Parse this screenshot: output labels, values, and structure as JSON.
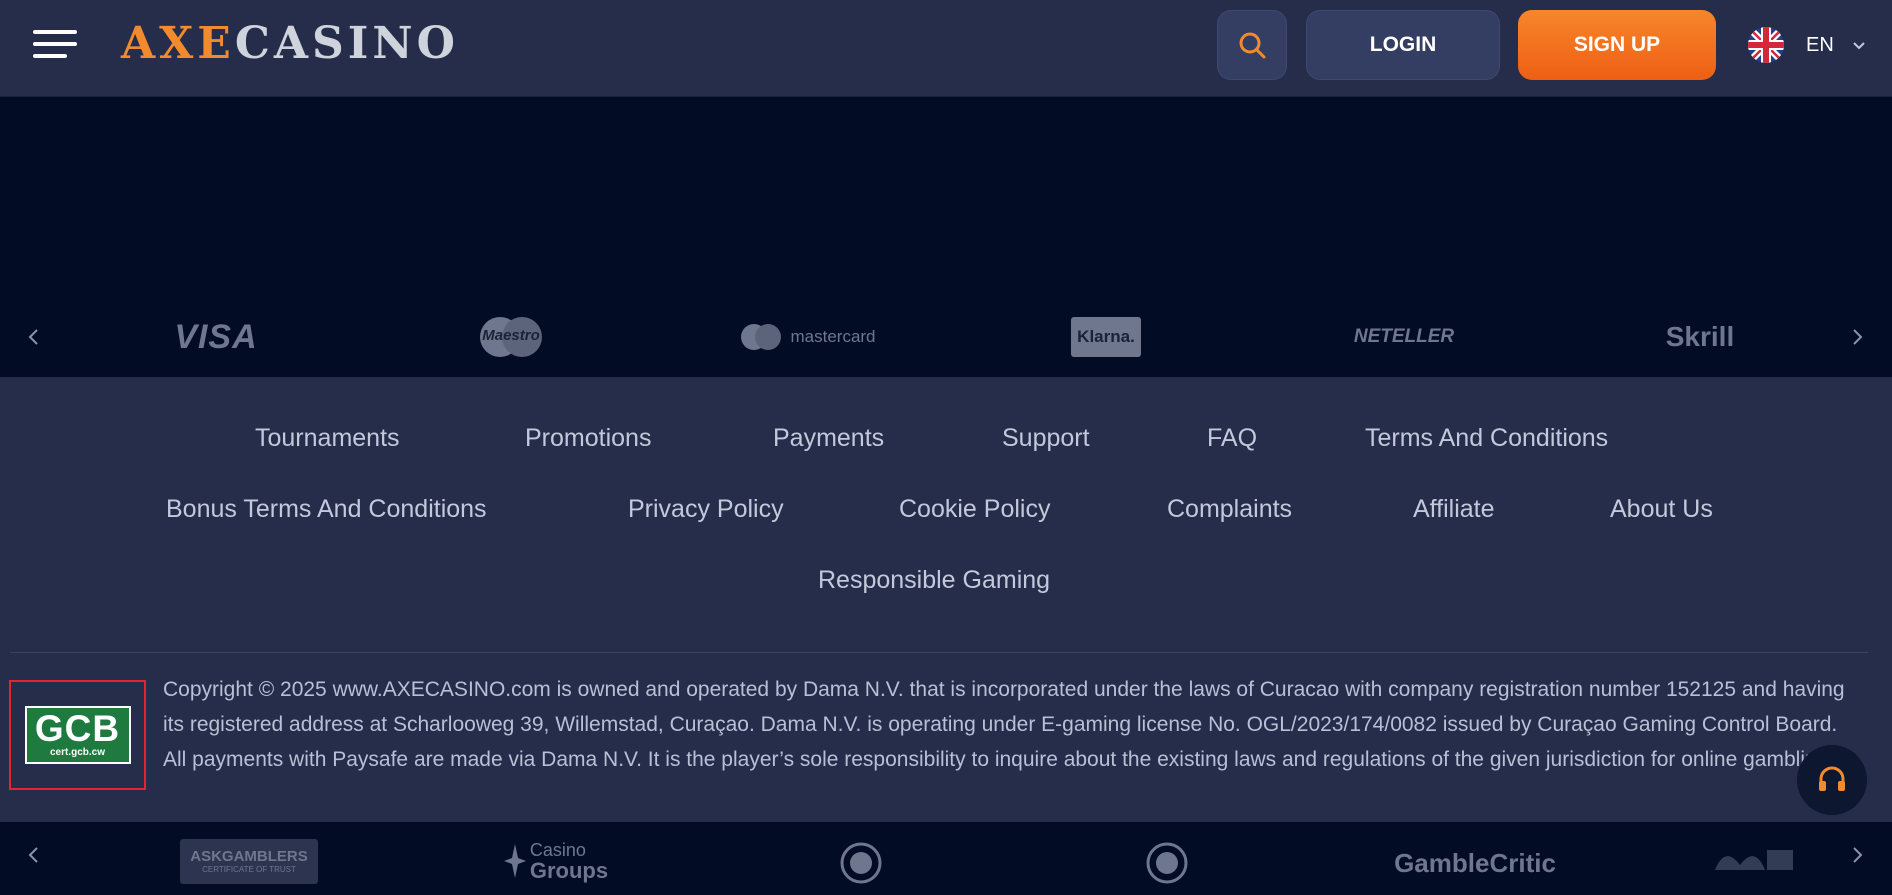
{
  "header": {
    "logo_axe": "AXE",
    "logo_casino": "CASINO",
    "login_label": "LOGIN",
    "signup_label": "SIGN UP",
    "language": "EN"
  },
  "payments": {
    "visa": "VISA",
    "maestro": "Maestro",
    "mastercard": "mastercard",
    "klarna": "Klarna.",
    "neteller": "NETELLER",
    "skrill": "Skrill"
  },
  "footer": {
    "links": [
      "Tournaments",
      "Promotions",
      "Payments",
      "Support",
      "FAQ",
      "Terms And Conditions",
      "Bonus Terms And Conditions",
      "Privacy Policy",
      "Cookie Policy",
      "Complaints",
      "Affiliate",
      "About Us",
      "Responsible Gaming"
    ],
    "copyright": "Copyright © 2025 www.AXECASINO.com is owned and operated by Dama N.V. that is incorporated under the laws of Curacao with company registration number 152125 and having its registered address at Scharlooweg 39, Willemstad, Curaçao. Dama N.V. is operating under E-gaming license No. OGL/2023/174/0082 issued by Curaçao Gaming Control Board. All payments with Paysafe are made via Dama N.V. It is the player’s sole responsibility to inquire about the existing laws and regulations of the given jurisdiction for online gambling.",
    "gcb_title": "GCB",
    "gcb_sub": "cert.gcb.cw"
  },
  "partners": {
    "askgamblers": "ASKGAMBLERS",
    "askgamblers_sub": "CERTIFICATE OF TRUST",
    "casino_groups_1": "Casino",
    "casino_groups_2": "Groups",
    "gamblecritic": "GambleCritic"
  },
  "colors": {
    "accent": "#f28a2e",
    "signup_gradient_top": "#f7862a",
    "signup_gradient_bottom": "#ee5f14",
    "background": "#252d4b",
    "dark_band": "#030c25",
    "license_highlight": "#e3262c"
  }
}
